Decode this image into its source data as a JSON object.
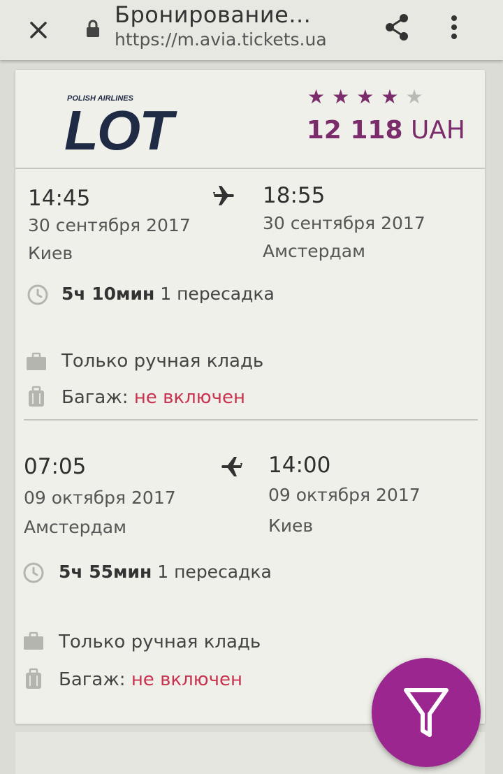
{
  "browser": {
    "title": "Бронирование...",
    "url": "https://m.avia.tickets.ua"
  },
  "offer": {
    "airline_tagline": "POLISH AIRLINES",
    "airline_logo_text": "LOT",
    "rating": {
      "value": 4,
      "max": 5
    },
    "price_amount": "12 118",
    "price_currency": "UAH",
    "colors": {
      "accent": "#7a2c6b",
      "fab": "#9c2690",
      "warning": "#c8324f"
    },
    "segments": [
      {
        "depart_time": "14:45",
        "depart_date": "30 сентября 2017",
        "depart_city": "Киев",
        "arrive_time": "18:55",
        "arrive_date": "30 сентября 2017",
        "arrive_city": "Амстердам",
        "duration": "5ч 10мин",
        "stops": "1 пересадка",
        "hand_luggage": "Только ручная кладь",
        "baggage_label": "Багаж:",
        "baggage_status": "не включен"
      },
      {
        "depart_time": "07:05",
        "depart_date": "09 октября 2017",
        "depart_city": "Амстердам",
        "arrive_time": "14:00",
        "arrive_date": "09 октября 2017",
        "arrive_city": "Киев",
        "duration": "5ч 55мин",
        "stops": "1 пересадка",
        "hand_luggage": "Только ручная кладь",
        "baggage_label": "Багаж:",
        "baggage_status": "не включен"
      }
    ]
  },
  "icons": {
    "close": "close-icon",
    "lock": "lock-icon",
    "share": "share-icon",
    "menu": "more-vertical-icon",
    "plane": "airplane-icon",
    "clock": "clock-icon",
    "hand_luggage": "briefcase-icon",
    "baggage": "suitcase-icon",
    "filter": "filter-icon"
  }
}
